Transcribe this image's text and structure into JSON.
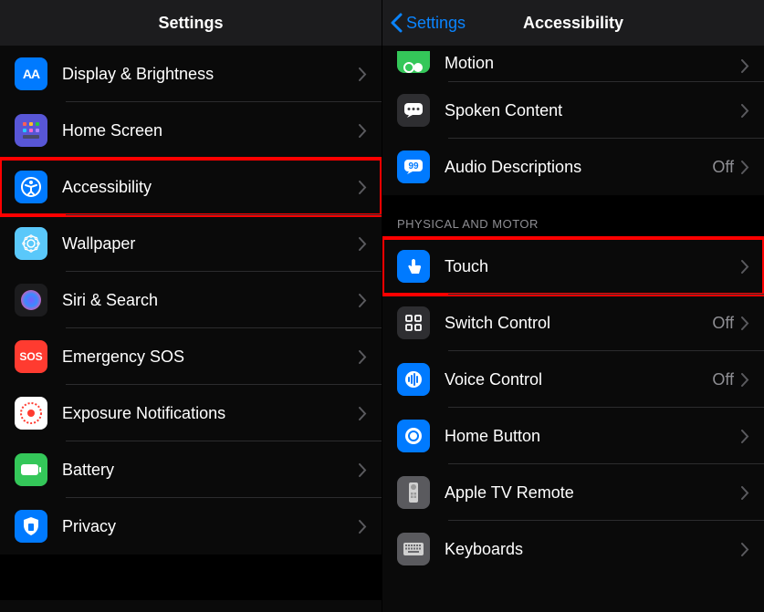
{
  "left": {
    "title": "Settings",
    "items": [
      {
        "label": "Display & Brightness"
      },
      {
        "label": "Home Screen"
      },
      {
        "label": "Accessibility",
        "highlighted": true
      },
      {
        "label": "Wallpaper"
      },
      {
        "label": "Siri & Search"
      },
      {
        "label": "Emergency SOS"
      },
      {
        "label": "Exposure Notifications"
      },
      {
        "label": "Battery"
      },
      {
        "label": "Privacy"
      }
    ]
  },
  "right": {
    "back_label": "Settings",
    "title": "Accessibility",
    "items_top": [
      {
        "label": "Motion"
      },
      {
        "label": "Spoken Content"
      },
      {
        "label": "Audio Descriptions",
        "value": "Off"
      }
    ],
    "section_header": "PHYSICAL AND MOTOR",
    "items_bottom": [
      {
        "label": "Touch",
        "highlighted": true
      },
      {
        "label": "Switch Control",
        "value": "Off"
      },
      {
        "label": "Voice Control",
        "value": "Off"
      },
      {
        "label": "Home Button"
      },
      {
        "label": "Apple TV Remote"
      },
      {
        "label": "Keyboards"
      }
    ]
  }
}
